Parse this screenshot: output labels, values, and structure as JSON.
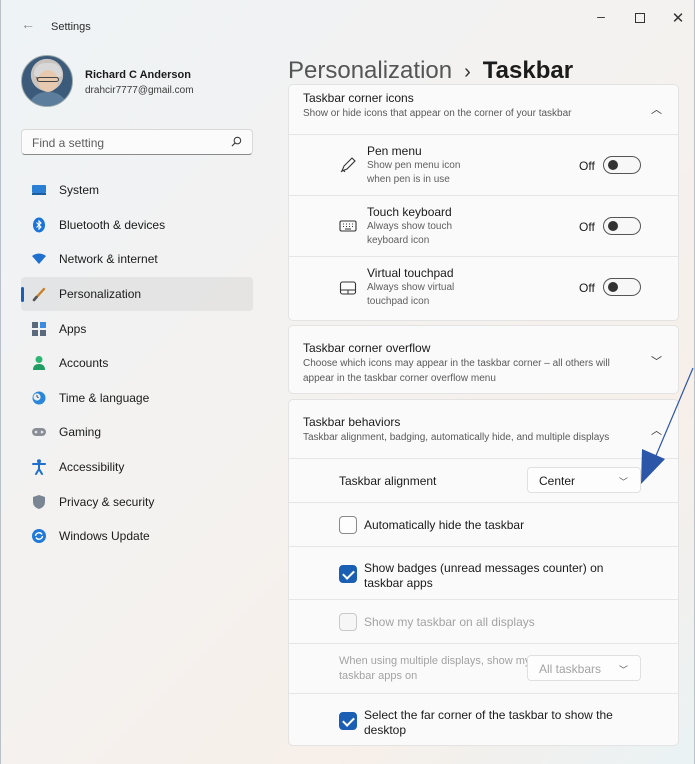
{
  "window": {
    "title": "Settings",
    "back_icon": "←",
    "minimize": "–",
    "close": "✕"
  },
  "user": {
    "name": "Richard C Anderson",
    "email": "drahcir7777@gmail.com"
  },
  "search": {
    "placeholder": "Find a setting"
  },
  "sidebar": {
    "items": [
      {
        "label": "System",
        "icon": "monitor-icon"
      },
      {
        "label": "Bluetooth & devices",
        "icon": "bluetooth-icon"
      },
      {
        "label": "Network & internet",
        "icon": "wifi-icon"
      },
      {
        "label": "Personalization",
        "icon": "brush-icon",
        "active": true
      },
      {
        "label": "Apps",
        "icon": "apps-icon"
      },
      {
        "label": "Accounts",
        "icon": "person-icon"
      },
      {
        "label": "Time & language",
        "icon": "globe-clock-icon"
      },
      {
        "label": "Gaming",
        "icon": "gamepad-icon"
      },
      {
        "label": "Accessibility",
        "icon": "accessibility-icon"
      },
      {
        "label": "Privacy & security",
        "icon": "shield-icon"
      },
      {
        "label": "Windows Update",
        "icon": "update-icon"
      }
    ]
  },
  "breadcrumb": {
    "parent": "Personalization",
    "separator": "›",
    "current": "Taskbar"
  },
  "corner_icons": {
    "title": "Taskbar corner icons",
    "desc": "Show or hide icons that appear on the corner of your taskbar",
    "items": [
      {
        "title": "Pen menu",
        "sub": "Show pen menu icon when pen is in use",
        "state": "Off"
      },
      {
        "title": "Touch keyboard",
        "sub": "Always show touch keyboard icon",
        "state": "Off"
      },
      {
        "title": "Virtual touchpad",
        "sub": "Always show virtual touchpad icon",
        "state": "Off"
      }
    ]
  },
  "overflow": {
    "title": "Taskbar corner overflow",
    "desc": "Choose which icons may appear in the taskbar corner – all others will appear in the taskbar corner overflow menu"
  },
  "behaviors": {
    "title": "Taskbar behaviors",
    "desc": "Taskbar alignment, badging, automatically hide, and multiple displays",
    "alignment_label": "Taskbar alignment",
    "alignment_value": "Center",
    "auto_hide": "Automatically hide the taskbar",
    "badges": "Show badges (unread messages counter) on taskbar apps",
    "all_displays": "Show my taskbar on all displays",
    "multi_label": "When using multiple displays, show my taskbar apps on",
    "multi_value": "All taskbars",
    "far_corner": "Select the far corner of the taskbar to show the desktop"
  },
  "colors": {
    "accent": "#1a5fb4",
    "annotation": "#2c56a8"
  }
}
